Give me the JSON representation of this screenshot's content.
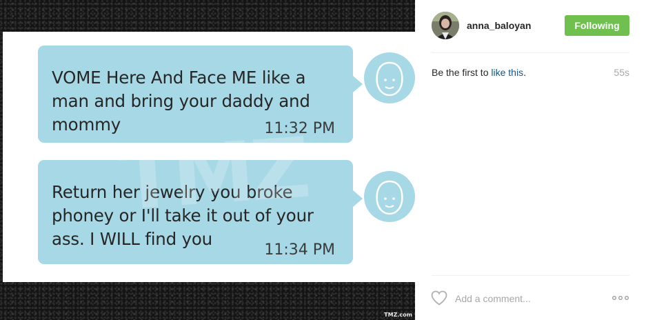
{
  "post": {
    "messages": [
      {
        "text": "VOME Here And Face ME like a man and bring your daddy and mommy",
        "time": "11:32 PM"
      },
      {
        "text": "Return her jewelry you broke phoney or I'll take it out of your ass. I WILL find you",
        "time": "11:34 PM"
      }
    ],
    "watermark": "TMZ",
    "credit": "TMZ.com"
  },
  "panel": {
    "username": "anna_baloyan",
    "follow_label": "Following",
    "likes_prefix": "Be the first to ",
    "likes_link": "like this",
    "likes_suffix": ".",
    "time_ago": "55s",
    "comment_placeholder": "Add a comment...",
    "follow_color": "#70c050",
    "link_color": "#125688"
  },
  "icons": {
    "heart": "heart-icon",
    "more": "more-options-icon",
    "contact_avatar": "contact-avatar-icon"
  }
}
